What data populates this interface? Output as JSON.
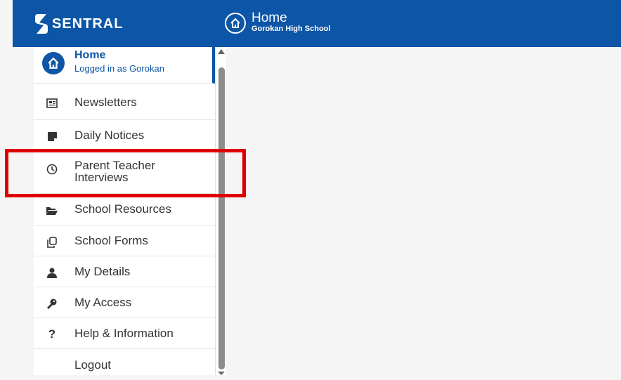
{
  "header": {
    "brand": "SENTRAL",
    "page_title": "Home",
    "school": "Gorokan High School",
    "color": "#0d55a6"
  },
  "sidebar": {
    "active": {
      "title": "Home",
      "subtitle": "Logged in as Gorokan",
      "icon": "home-icon"
    },
    "items": [
      {
        "label": "Newsletters",
        "icon": "newspaper-icon"
      },
      {
        "label": "Daily Notices",
        "icon": "sticky-note-icon"
      },
      {
        "label": "Parent Teacher Interviews",
        "icon": "clock-icon"
      },
      {
        "label": "School Resources",
        "icon": "folder-open-icon"
      },
      {
        "label": "School Forms",
        "icon": "copy-icon"
      },
      {
        "label": "My Details",
        "icon": "user-icon"
      },
      {
        "label": "My Access",
        "icon": "key-icon"
      },
      {
        "label": "Help & Information",
        "icon": "question-icon"
      },
      {
        "label": "Logout",
        "icon": ""
      }
    ]
  },
  "annotation": {
    "highlight_color": "#e00000"
  }
}
